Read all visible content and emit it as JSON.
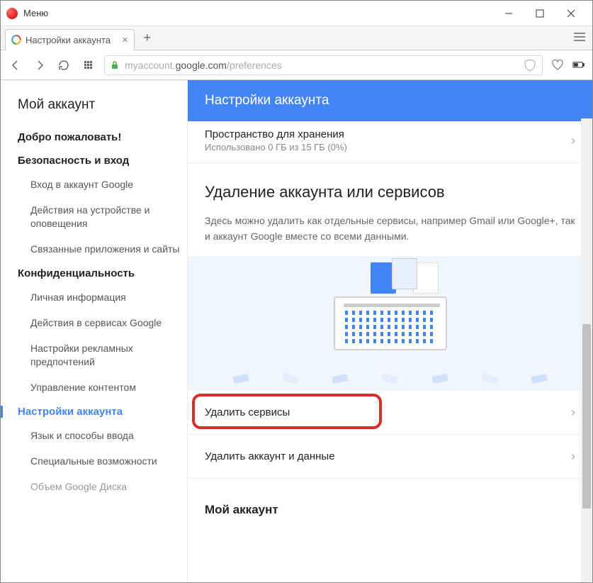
{
  "titlebar": {
    "menu_label": "Меню"
  },
  "tab": {
    "title": "Настройки аккаунта"
  },
  "address": {
    "prefix": "myaccount.",
    "host": "google.com",
    "path": "/preferences"
  },
  "sidebar": {
    "title": "Мой аккаунт",
    "sections": [
      {
        "label": "Добро пожаловать!",
        "items": []
      },
      {
        "label": "Безопасность и вход",
        "items": [
          "Вход в аккаунт Google",
          "Действия на устройстве и оповещения",
          "Связанные приложения и сайты"
        ]
      },
      {
        "label": "Конфиденциальность",
        "items": [
          "Личная информация",
          "Действия в сервисах Google",
          "Настройки рекламных предпочтений",
          "Управление контентом"
        ]
      },
      {
        "label": "Настройки аккаунта",
        "active": true,
        "items": [
          "Язык и способы ввода",
          "Специальные возможности",
          "Объем Google Диска"
        ]
      }
    ]
  },
  "main": {
    "header": "Настройки аккаунта",
    "storage": {
      "title": "Пространство для хранения",
      "subtitle": "Использовано 0 ГБ из 15 ГБ (0%)"
    },
    "delete_section": {
      "title": "Удаление аккаунта или сервисов",
      "description": "Здесь можно удалить как отдельные сервисы, например Gmail или Google+, так и аккаунт Google вместе со всеми данными."
    },
    "actions": {
      "delete_services": "Удалить сервисы",
      "delete_account": "Удалить аккаунт и данные"
    },
    "footer": "Мой аккаунт"
  }
}
